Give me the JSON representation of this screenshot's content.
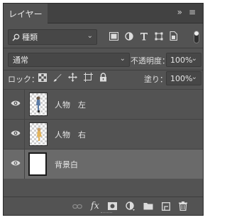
{
  "panel": {
    "tab_label": "レイヤー",
    "tab_close": "×",
    "collapse_label": "»",
    "menu_label": "≡"
  },
  "filter": {
    "kind_label": "種類",
    "icons": [
      "image-filter-icon",
      "adjustment-filter-icon",
      "type-filter-icon",
      "shape-filter-icon",
      "smart-object-filter-icon"
    ]
  },
  "blend": {
    "mode": "通常",
    "opacity_label": "不透明度：",
    "opacity_value": "100%"
  },
  "lock": {
    "label": "ロック：",
    "icons": [
      "lock-transparent-pixels-icon",
      "lock-image-pixels-icon",
      "lock-position-icon",
      "prevent-autonest-icon",
      "lock-all-icon"
    ],
    "fill_label": "塗り：",
    "fill_value": "100%"
  },
  "layers": [
    {
      "name": "人物　左",
      "visible": true,
      "selected": false,
      "thumb": "transparent"
    },
    {
      "name": "人物　右",
      "visible": true,
      "selected": false,
      "thumb": "transparent"
    },
    {
      "name": "背景白",
      "visible": true,
      "selected": true,
      "thumb": "white"
    }
  ],
  "bottom_toolbar": {
    "icons": [
      "link-layers-icon",
      "fx-icon",
      "add-mask-icon",
      "new-fill-adjustment-icon",
      "new-group-icon",
      "new-layer-icon",
      "delete-layer-icon"
    ],
    "fx_label": "fx"
  }
}
